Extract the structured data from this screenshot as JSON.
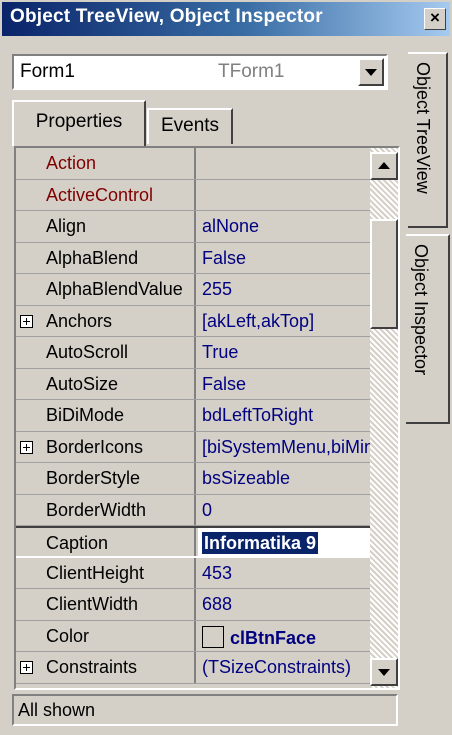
{
  "window": {
    "title": "Object TreeView, Object Inspector",
    "close_glyph": "×"
  },
  "component_selector": {
    "name": "Form1",
    "type": "TForm1"
  },
  "tabs": {
    "properties": "Properties",
    "events": "Events"
  },
  "side_tabs": {
    "tree_view": "Object TreeView",
    "inspector": "Object Inspector"
  },
  "properties": [
    {
      "name": "Action",
      "value": "",
      "kind": "event"
    },
    {
      "name": "ActiveControl",
      "value": "",
      "kind": "event"
    },
    {
      "name": "Align",
      "value": "alNone"
    },
    {
      "name": "AlphaBlend",
      "value": "False"
    },
    {
      "name": "AlphaBlendValue",
      "value": "255"
    },
    {
      "name": "Anchors",
      "value": "[akLeft,akTop]",
      "expandable": true
    },
    {
      "name": "AutoScroll",
      "value": "True"
    },
    {
      "name": "AutoSize",
      "value": "False"
    },
    {
      "name": "BiDiMode",
      "value": "bdLeftToRight"
    },
    {
      "name": "BorderIcons",
      "value": "[biSystemMenu,biMinimize,biMaximize]",
      "expandable": true
    },
    {
      "name": "BorderStyle",
      "value": "bsSizeable"
    },
    {
      "name": "BorderWidth",
      "value": "0"
    },
    {
      "name": "Caption",
      "value": "Informatika 9",
      "selected": true
    },
    {
      "name": "ClientHeight",
      "value": "453"
    },
    {
      "name": "ClientWidth",
      "value": "688"
    },
    {
      "name": "Color",
      "value": "clBtnFace",
      "swatch": true
    },
    {
      "name": "Constraints",
      "value": "(TSizeConstraints)",
      "expandable": true
    }
  ],
  "status": {
    "text": "All shown"
  },
  "colors": {
    "title_start": "#0a246a",
    "title_end": "#a6caf0",
    "value_text": "#000080",
    "event_text": "#800000",
    "face": "#d4d0c8"
  },
  "scrollbar": {
    "position": 0.1
  }
}
